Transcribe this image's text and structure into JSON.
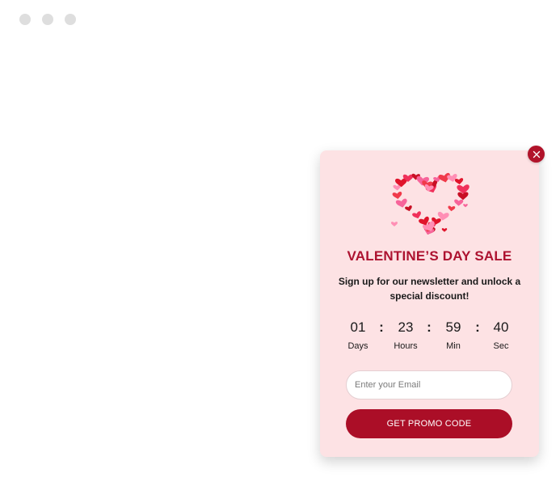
{
  "popup": {
    "title": "VALENTINE’S DAY SALE",
    "subtitle": "Sign up for our newsletter and unlock a special discount!",
    "countdown": [
      {
        "value": "01",
        "label": "Days"
      },
      {
        "value": "23",
        "label": "Hours"
      },
      {
        "value": "59",
        "label": "Min"
      },
      {
        "value": "40",
        "label": "Sec"
      }
    ],
    "separator": ":",
    "email_placeholder": "Enter your Email",
    "button_label": "GET PROMO CODE",
    "close_icon": "close-icon",
    "image_icon": "heart-of-hearts-icon"
  },
  "colors": {
    "popup_bg": "#fde2e4",
    "accent": "#ab0e27",
    "window_dot": "#dedede"
  }
}
